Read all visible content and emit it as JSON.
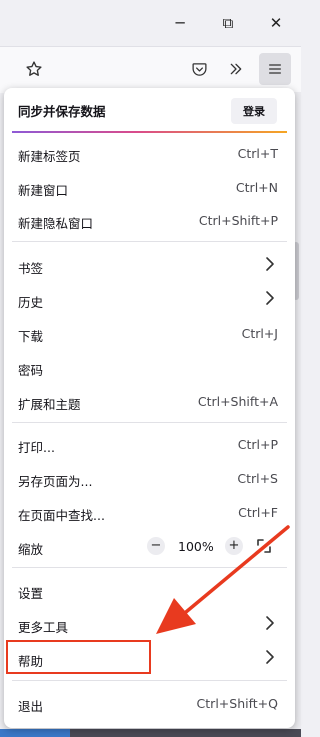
{
  "window_controls": {
    "minimize": "─",
    "restore": "⧉",
    "close": "✕"
  },
  "toolbar": {
    "icons": [
      "star-icon",
      "pocket-icon",
      "overflow-icon",
      "hamburger-menu-icon"
    ]
  },
  "menu": {
    "sync_label": "同步并保存数据",
    "login_label": "登录",
    "items": [
      {
        "label": "新建标签页",
        "shortcut": "Ctrl+T"
      },
      {
        "label": "新建窗口",
        "shortcut": "Ctrl+N"
      },
      {
        "label": "新建隐私窗口",
        "shortcut": "Ctrl+Shift+P"
      },
      {
        "label": "书签",
        "submenu": true
      },
      {
        "label": "历史",
        "submenu": true
      },
      {
        "label": "下载",
        "shortcut": "Ctrl+J"
      },
      {
        "label": "密码"
      },
      {
        "label": "扩展和主题",
        "shortcut": "Ctrl+Shift+A"
      },
      {
        "label": "打印...",
        "shortcut": "Ctrl+P"
      },
      {
        "label": "另存页面为...",
        "shortcut": "Ctrl+S"
      },
      {
        "label": "在页面中查找...",
        "shortcut": "Ctrl+F"
      },
      {
        "label": "缩放"
      },
      {
        "label": "设置"
      },
      {
        "label": "更多工具",
        "submenu": true
      },
      {
        "label": "帮助",
        "submenu": true
      },
      {
        "label": "退出",
        "shortcut": "Ctrl+Shift+Q"
      }
    ],
    "zoom": {
      "minus": "−",
      "value": "100%",
      "plus": "+"
    }
  },
  "colors": {
    "highlight_box": "#e83a1f",
    "arrow": "#e83a1f",
    "panel_bg": "#ffffff",
    "chrome_bg": "#f0f0f4"
  }
}
